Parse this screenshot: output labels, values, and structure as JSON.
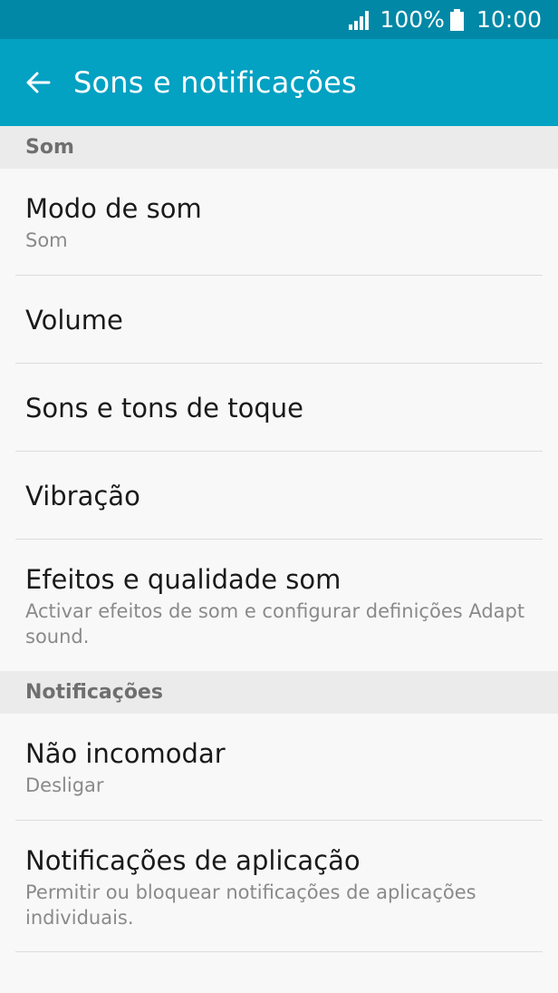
{
  "status_bar": {
    "battery": "100%",
    "time": "10:00"
  },
  "app_bar": {
    "title": "Sons e notificações"
  },
  "sections": [
    {
      "header": "Som",
      "items": [
        {
          "title": "Modo de som",
          "subtitle": "Som"
        },
        {
          "title": "Volume"
        },
        {
          "title": "Sons e tons de toque"
        },
        {
          "title": "Vibração"
        },
        {
          "title": "Efeitos e qualidade som",
          "subtitle": "Activar efeitos de som e configurar definições Adapt sound."
        }
      ]
    },
    {
      "header": "Notificações",
      "items": [
        {
          "title": "Não incomodar",
          "subtitle": "Desligar"
        },
        {
          "title": "Notificações de aplicação",
          "subtitle": "Permitir ou bloquear notificações de aplicações individuais."
        }
      ]
    }
  ],
  "colors": {
    "status_bar": "#0088a6",
    "app_bar": "#03a1c2",
    "section_header": "#ebebeb"
  }
}
